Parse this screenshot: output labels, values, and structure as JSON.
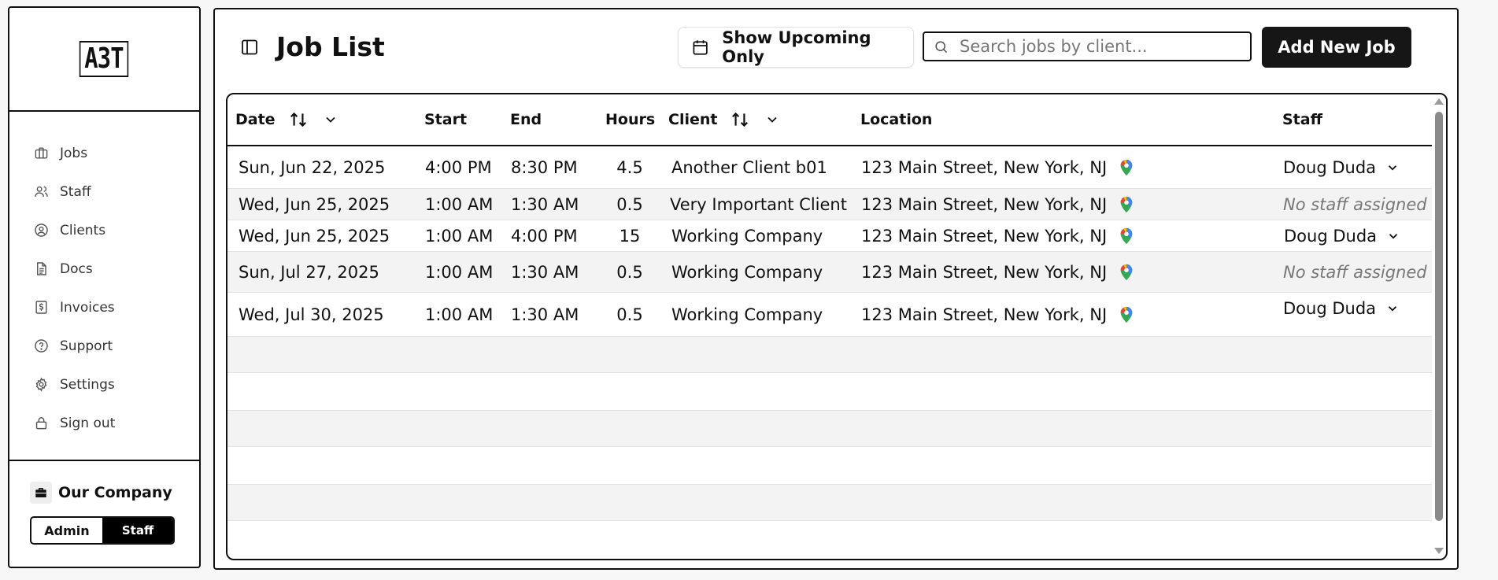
{
  "sidebar": {
    "logo_text": "A3T",
    "nav": [
      {
        "label": "Jobs",
        "icon": "briefcase-icon"
      },
      {
        "label": "Staff",
        "icon": "users-icon"
      },
      {
        "label": "Clients",
        "icon": "user-circle-icon"
      },
      {
        "label": "Docs",
        "icon": "document-icon"
      },
      {
        "label": "Invoices",
        "icon": "invoice-icon"
      },
      {
        "label": "Support",
        "icon": "help-circle-icon"
      },
      {
        "label": "Settings",
        "icon": "gear-icon"
      },
      {
        "label": "Sign out",
        "icon": "lock-icon"
      }
    ],
    "company_name": "Our Company",
    "roles": {
      "admin": "Admin",
      "staff": "Staff",
      "active": "Staff"
    }
  },
  "header": {
    "title": "Job List",
    "upcoming_label": "Show Upcoming Only",
    "search_placeholder": "Search jobs by client...",
    "add_label": "Add New Job"
  },
  "table": {
    "columns": {
      "date": "Date",
      "start": "Start",
      "end": "End",
      "hours": "Hours",
      "client": "Client",
      "location": "Location",
      "staff": "Staff"
    },
    "rows": [
      {
        "date": "Sun, Jun 22, 2025",
        "start": "4:00 PM",
        "end": "8:30 PM",
        "hours": "4.5",
        "client": "Another Client b01",
        "location": "123 Main Street, New York, NJ",
        "staff": "Doug Duda",
        "assigned": true
      },
      {
        "date": "Wed, Jun 25, 2025",
        "start": "1:00 AM",
        "end": "1:30 AM",
        "hours": "0.5",
        "client": "Very Important Client",
        "location": "123 Main Street, New York, NJ",
        "staff": "No staff assigned",
        "assigned": false
      },
      {
        "date": "Wed, Jun 25, 2025",
        "start": "1:00 AM",
        "end": "4:00 PM",
        "hours": "15",
        "client": "Working Company",
        "location": "123 Main Street, New York, NJ",
        "staff": "Doug Duda",
        "assigned": true
      },
      {
        "date": "Sun, Jul 27, 2025",
        "start": "1:00 AM",
        "end": "1:30 AM",
        "hours": "0.5",
        "client": "Working Company",
        "location": "123 Main Street, New York, NJ",
        "staff": "No staff assigned",
        "assigned": false
      },
      {
        "date": "Wed, Jul 30, 2025",
        "start": "1:00 AM",
        "end": "1:30 AM",
        "hours": "0.5",
        "client": "Working Company",
        "location": "123 Main Street, New York, NJ",
        "staff": "Doug Duda",
        "assigned": true
      }
    ]
  },
  "colors": {
    "primary": "#161616",
    "muted_text": "#777777",
    "row_alt": "#f3f3f3"
  }
}
